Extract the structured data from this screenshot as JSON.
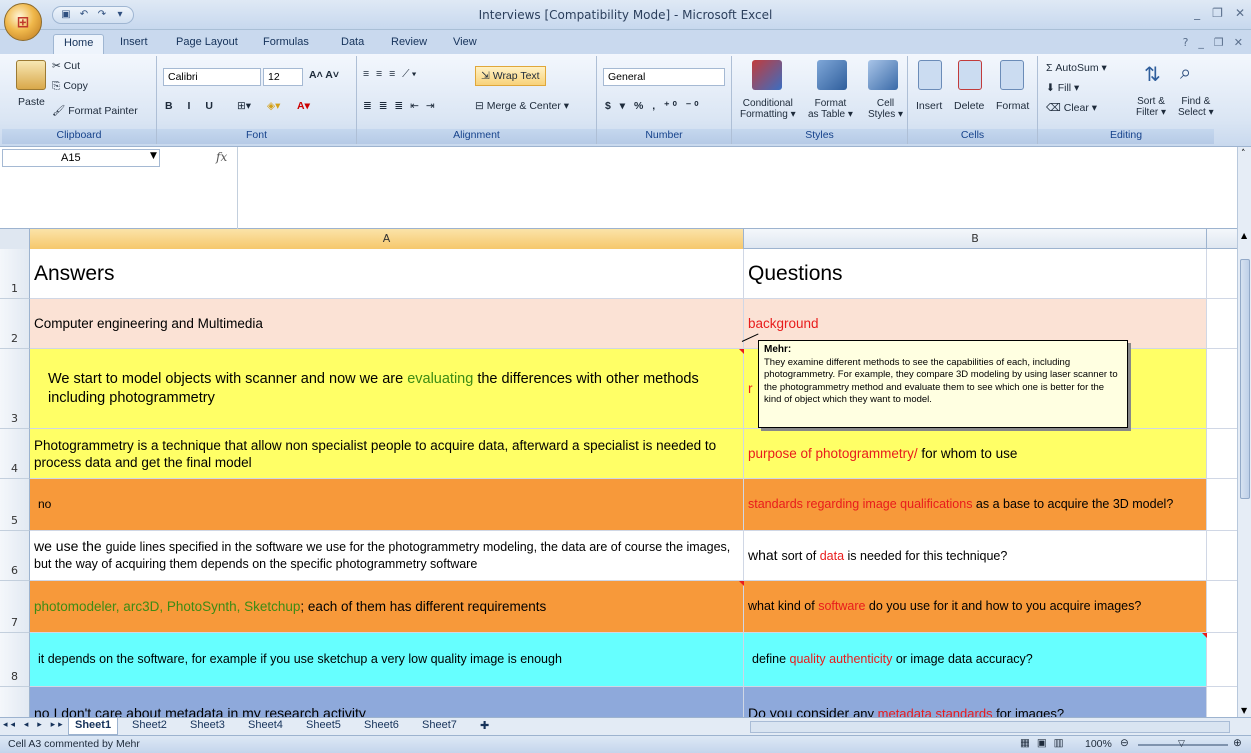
{
  "window": {
    "title": "Interviews  [Compatibility Mode] - Microsoft Excel"
  },
  "office_button": {
    "icon": "office-logo-icon"
  },
  "tabs": [
    "Home",
    "Insert",
    "Page Layout",
    "Formulas",
    "Data",
    "Review",
    "View"
  ],
  "ribbon": {
    "clipboard": {
      "paste": "Paste",
      "cut": "Cut",
      "copy": "Copy",
      "format_painter": "Format Painter",
      "label": "Clipboard"
    },
    "font": {
      "name": "Calibri",
      "size": "12",
      "label": "Font"
    },
    "alignment": {
      "wrap_text": "Wrap Text",
      "merge_center": "Merge & Center",
      "label": "Alignment"
    },
    "number": {
      "format": "General",
      "label": "Number"
    },
    "styles": {
      "conditional": "Conditional",
      "conditional2": "Formatting",
      "format_table": "Format",
      "format_table2": "as Table",
      "cell_styles": "Cell",
      "cell_styles2": "Styles",
      "label": "Styles"
    },
    "cells": {
      "insert": "Insert",
      "delete": "Delete",
      "format": "Format",
      "label": "Cells"
    },
    "editing": {
      "autosum": "AutoSum",
      "fill": "Fill",
      "clear": "Clear",
      "sort": "Sort &",
      "sort2": "Filter",
      "find": "Find &",
      "find2": "Select",
      "label": "Editing"
    }
  },
  "formula_bar": {
    "name_box": "A15",
    "fx": "fx"
  },
  "columns": {
    "a": "A",
    "b": "B"
  },
  "rows": [
    {
      "num": "1",
      "a": "Answers",
      "b": "Questions"
    },
    {
      "num": "2",
      "a": "Computer engineering and Multimedia",
      "b": "background"
    },
    {
      "num": "3",
      "a1": "We start to model objects with scanner and now we are ",
      "a_hl": "evaluating",
      "a2": " the differences with other methods including photogrammetry",
      "b": "r"
    },
    {
      "num": "4",
      "a": "Photogrammetry is a technique that allow non specialist people to acquire data, afterward a specialist is needed to process data and get the final model",
      "b_hl": "purpose of photogrammetry/",
      "b2": " for whom to use"
    },
    {
      "num": "5",
      "a": "no",
      "b_hl": "standards regarding image qualifications",
      "b2": " as a base to acquire the 3D model?"
    },
    {
      "num": "6",
      "a1": "we use the ",
      "a2": "guide lines specified in the software we use for the photogrammetry modeling, the data are of course the images, but the way of acquiring them depends on the specific photogrammetry software",
      "b1": "what ",
      "b2": "sort of ",
      "b_hl": "data",
      "b3": " is needed for this technique?"
    },
    {
      "num": "7",
      "a_hl": "photomodeler, arc3D, PhotoSynth, Sketchup",
      "a2": "; each of them has different requirements",
      "b1": "what kind of ",
      "b_hl": "software",
      "b2": " do you use for it and how to you acquire images?"
    },
    {
      "num": "8",
      "a": "it depends on the software, for example if you use sketchup a very low quality image is enough",
      "b1": "define ",
      "b_hl": "quality authenticity",
      "b2": " or image data accuracy?"
    },
    {
      "num": "9",
      "a": "no I don't care about metadata in my research activity",
      "b1": "Do you consider ",
      "b2": "any ",
      "b_hl": "metadata standards",
      "b3": " for images?"
    }
  ],
  "comment": {
    "author": "Mehr:",
    "text": "They examine different methods to see the capabilities of each, including photogrammetry. For example, they compare 3D modeling by using laser scanner to the photogrammetry method and evaluate them to see which one is better for the kind of object which they want to model."
  },
  "sheets": [
    "Sheet1",
    "Sheet2",
    "Sheet3",
    "Sheet4",
    "Sheet5",
    "Sheet6",
    "Sheet7"
  ],
  "status": {
    "text": "Cell A3 commented by Mehr",
    "zoom": "100%"
  },
  "colors": {
    "row2": "#fbe2d5",
    "row3": "#ffff66",
    "row4": "#ffff66",
    "row5": "#f7993a",
    "row7": "#f7993a",
    "row8": "#66ffff",
    "row9": "#8ea9db"
  }
}
